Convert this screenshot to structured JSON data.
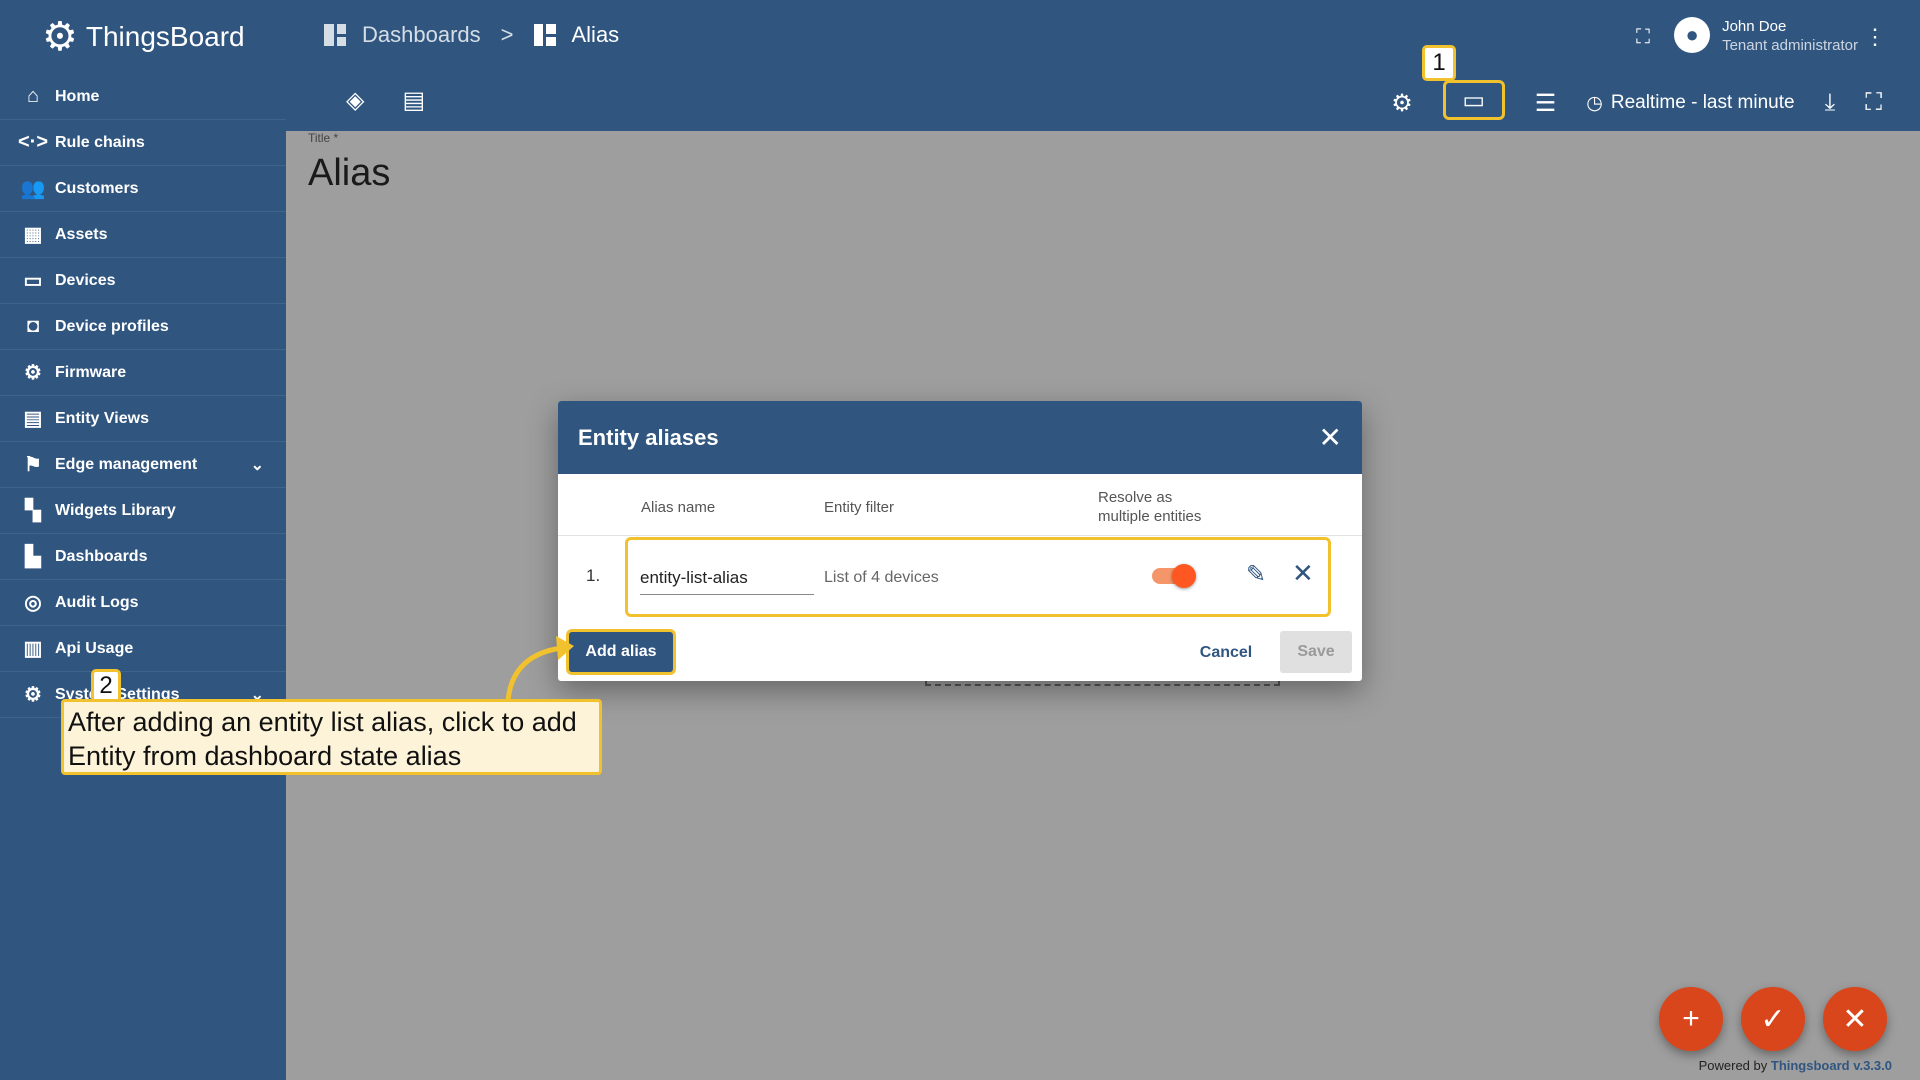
{
  "app": {
    "name": "ThingsBoard"
  },
  "sidebar": {
    "items": [
      {
        "label": "Home",
        "icon": "home-icon",
        "glyph": "⌂"
      },
      {
        "label": "Rule chains",
        "icon": "code-icon",
        "glyph": "<·>"
      },
      {
        "label": "Customers",
        "icon": "people-icon",
        "glyph": "👥"
      },
      {
        "label": "Assets",
        "icon": "domain-icon",
        "glyph": "▦"
      },
      {
        "label": "Devices",
        "icon": "devices-icon",
        "glyph": "▭"
      },
      {
        "label": "Device profiles",
        "icon": "device-profile-icon",
        "glyph": "◘"
      },
      {
        "label": "Firmware",
        "icon": "chip-icon",
        "glyph": "⚙"
      },
      {
        "label": "Entity Views",
        "icon": "view-icon",
        "glyph": "▤"
      },
      {
        "label": "Edge management",
        "icon": "router-icon",
        "glyph": "⚑",
        "expandable": true
      },
      {
        "label": "Widgets Library",
        "icon": "widgets-icon",
        "glyph": "▚"
      },
      {
        "label": "Dashboards",
        "icon": "dashboard-icon",
        "glyph": "▙"
      },
      {
        "label": "Audit Logs",
        "icon": "track-changes-icon",
        "glyph": "◎"
      },
      {
        "label": "Api Usage",
        "icon": "insert-chart-icon",
        "glyph": "▥"
      },
      {
        "label": "System Settings",
        "icon": "settings-icon",
        "glyph": "⚙",
        "expandable": true
      }
    ]
  },
  "header": {
    "breadcrumb": [
      "Dashboards",
      ">",
      "Alias"
    ],
    "user_name": "John Doe",
    "user_role": "Tenant administrator",
    "realtime": "Realtime - last minute"
  },
  "content": {
    "title_label": "Title *",
    "title": "Alias"
  },
  "dialog": {
    "title": "Entity aliases",
    "columns": {
      "alias_name": "Alias name",
      "entity_filter": "Entity filter",
      "resolve_line1": "Resolve as",
      "resolve_line2": "multiple entities"
    },
    "rows": [
      {
        "index": "1.",
        "alias_name": "entity-list-alias",
        "entity_filter": "List of 4 devices",
        "resolve_multiple": true
      }
    ],
    "add_alias": "Add alias",
    "cancel": "Cancel",
    "save": "Save"
  },
  "callouts": {
    "badge1": "1",
    "badge2": "2",
    "text": "After adding an entity list alias, click to add Entity from dashboard state alias"
  },
  "footer": {
    "powered_prefix": "Powered by",
    "powered_brand": "Thingsboard v.3.3.0"
  },
  "colors": {
    "primary": "#305680",
    "accent": "#d9461c",
    "highlight": "#f2c12e"
  }
}
